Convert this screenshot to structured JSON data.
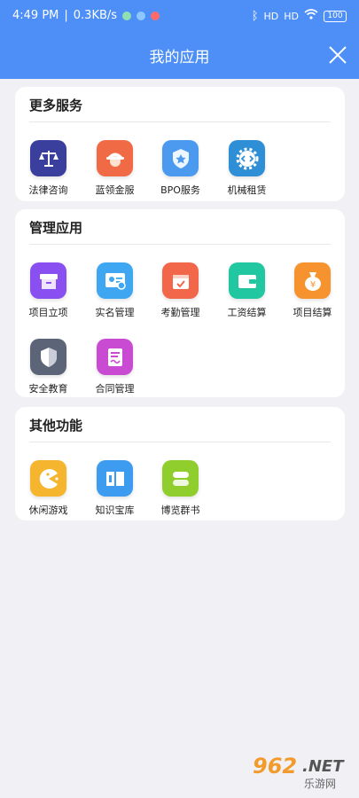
{
  "status_bar": {
    "time": "4:49 PM",
    "network_speed": "0.3KB/s",
    "signal_1": "HD",
    "signal_2": "HD",
    "battery": "100"
  },
  "header": {
    "title": "我的应用",
    "close_icon": "close-icon",
    "bg_color": "#4d8ff6"
  },
  "sections": [
    {
      "title": "更多服务",
      "items": [
        {
          "label": "法律咨询",
          "icon": "scales-icon",
          "color": "#3a3f9e"
        },
        {
          "label": "蓝领金服",
          "icon": "worker-helmet-icon",
          "color": "#ef6a45"
        },
        {
          "label": "BPO服务",
          "icon": "badge-star-icon",
          "color": "#4c9af0"
        },
        {
          "label": "机械租赁",
          "icon": "gear-code-icon",
          "color": "#2f8fd6"
        }
      ]
    },
    {
      "title": "管理应用",
      "items": [
        {
          "label": "项目立项",
          "icon": "box-icon",
          "color": "#8a4ff0"
        },
        {
          "label": "实名管理",
          "icon": "id-card-icon",
          "color": "#3fa7f2"
        },
        {
          "label": "考勤管理",
          "icon": "calendar-check-icon",
          "color": "#f26649"
        },
        {
          "label": "工资结算",
          "icon": "wallet-icon",
          "color": "#21c7a1"
        },
        {
          "label": "项目结算",
          "icon": "money-bag-icon",
          "color": "#f7932f"
        },
        {
          "label": "安全教育",
          "icon": "shield-icon",
          "color": "#5c6577"
        },
        {
          "label": "合同管理",
          "icon": "contract-icon",
          "color": "#c94bd2"
        }
      ]
    },
    {
      "title": "其他功能",
      "items": [
        {
          "label": "休闲游戏",
          "icon": "pacman-icon",
          "color": "#f5b52e"
        },
        {
          "label": "知识宝库",
          "icon": "book-icon",
          "color": "#3d9cef"
        },
        {
          "label": "博览群书",
          "icon": "stack-icon",
          "color": "#8fce2c"
        }
      ]
    }
  ],
  "watermark": {
    "num": "962",
    "net": ".NET",
    "text": "乐游网"
  }
}
